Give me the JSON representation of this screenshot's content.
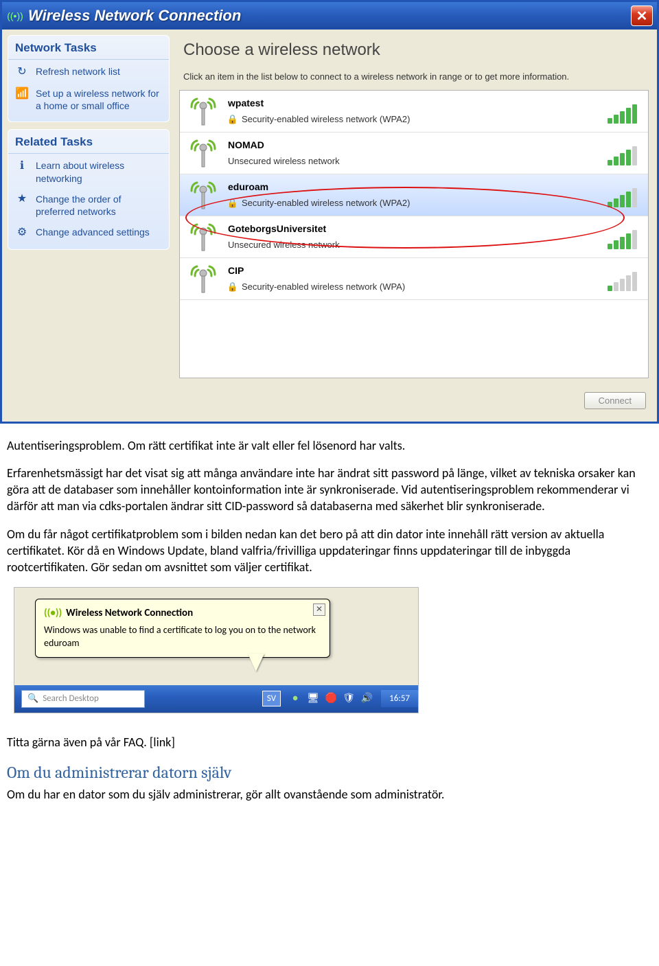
{
  "window": {
    "title": "Wireless Network Connection",
    "close": "✕"
  },
  "sidebar": {
    "tasks_header": "Network Tasks",
    "tasks": [
      {
        "icon": "↻",
        "label": "Refresh network list"
      },
      {
        "icon": "📶",
        "label": "Set up a wireless network for a home or small office"
      }
    ],
    "related_header": "Related Tasks",
    "related": [
      {
        "icon": "ℹ",
        "label": "Learn about wireless networking"
      },
      {
        "icon": "★",
        "label": "Change the order of preferred networks"
      },
      {
        "icon": "⚙",
        "label": "Change advanced settings"
      }
    ]
  },
  "main": {
    "title": "Choose a wireless network",
    "instr": "Click an item in the list below to connect to a wireless network in range or to get more information.",
    "networks": [
      {
        "name": "wpatest",
        "sec": "Security-enabled wireless network (WPA2)",
        "locked": true,
        "bars": 5,
        "sel": false
      },
      {
        "name": "NOMAD",
        "sec": "Unsecured wireless network",
        "locked": false,
        "bars": 4,
        "sel": false
      },
      {
        "name": "eduroam",
        "sec": "Security-enabled wireless network (WPA2)",
        "locked": true,
        "bars": 4,
        "sel": true
      },
      {
        "name": "GoteborgsUniversitet",
        "sec": "Unsecured wireless network",
        "locked": false,
        "bars": 4,
        "sel": false
      },
      {
        "name": "CIP",
        "sec": "Security-enabled wireless network (WPA)",
        "locked": true,
        "bars": 1,
        "sel": false
      }
    ],
    "connect": "Connect"
  },
  "doc": {
    "p1": "Autentiseringsproblem. Om rätt certifikat inte är valt eller fel lösenord har valts.",
    "p2": "Erfarenhetsmässigt har det visat sig att många användare inte har ändrat sitt password på länge, vilket av tekniska orsaker kan göra att de databaser som innehåller kontoinformation inte är synkroniserade. Vid autentiseringsproblem rekommenderar vi därför att man via cdks-portalen ändrar sitt CID-password så databaserna med säkerhet blir synkroniserade.",
    "p3": "Om du får något certifikatproblem som i bilden nedan kan det bero på att din dator inte innehåll rätt version av aktuella certifikatet. Kör då en Windows Update, bland valfria/frivilliga uppdateringar finns uppdateringar till de inbyggda rootcertifikaten. Gör sedan om avsnittet som väljer certifikat."
  },
  "balloon": {
    "title": "Wireless Network Connection",
    "text": "Windows was unable to find a certificate to log you on to the network eduroam",
    "close": "✕"
  },
  "taskbar": {
    "search_placeholder": "Search Desktop",
    "lang": "SV",
    "clock": "16:57"
  },
  "doc2": {
    "faq": "Titta gärna även på vår FAQ. [link]",
    "h2": "Om du administrerar datorn själv",
    "p4": "Om du har en dator som du själv administrerar, gör allt ovanstående som administratör."
  }
}
